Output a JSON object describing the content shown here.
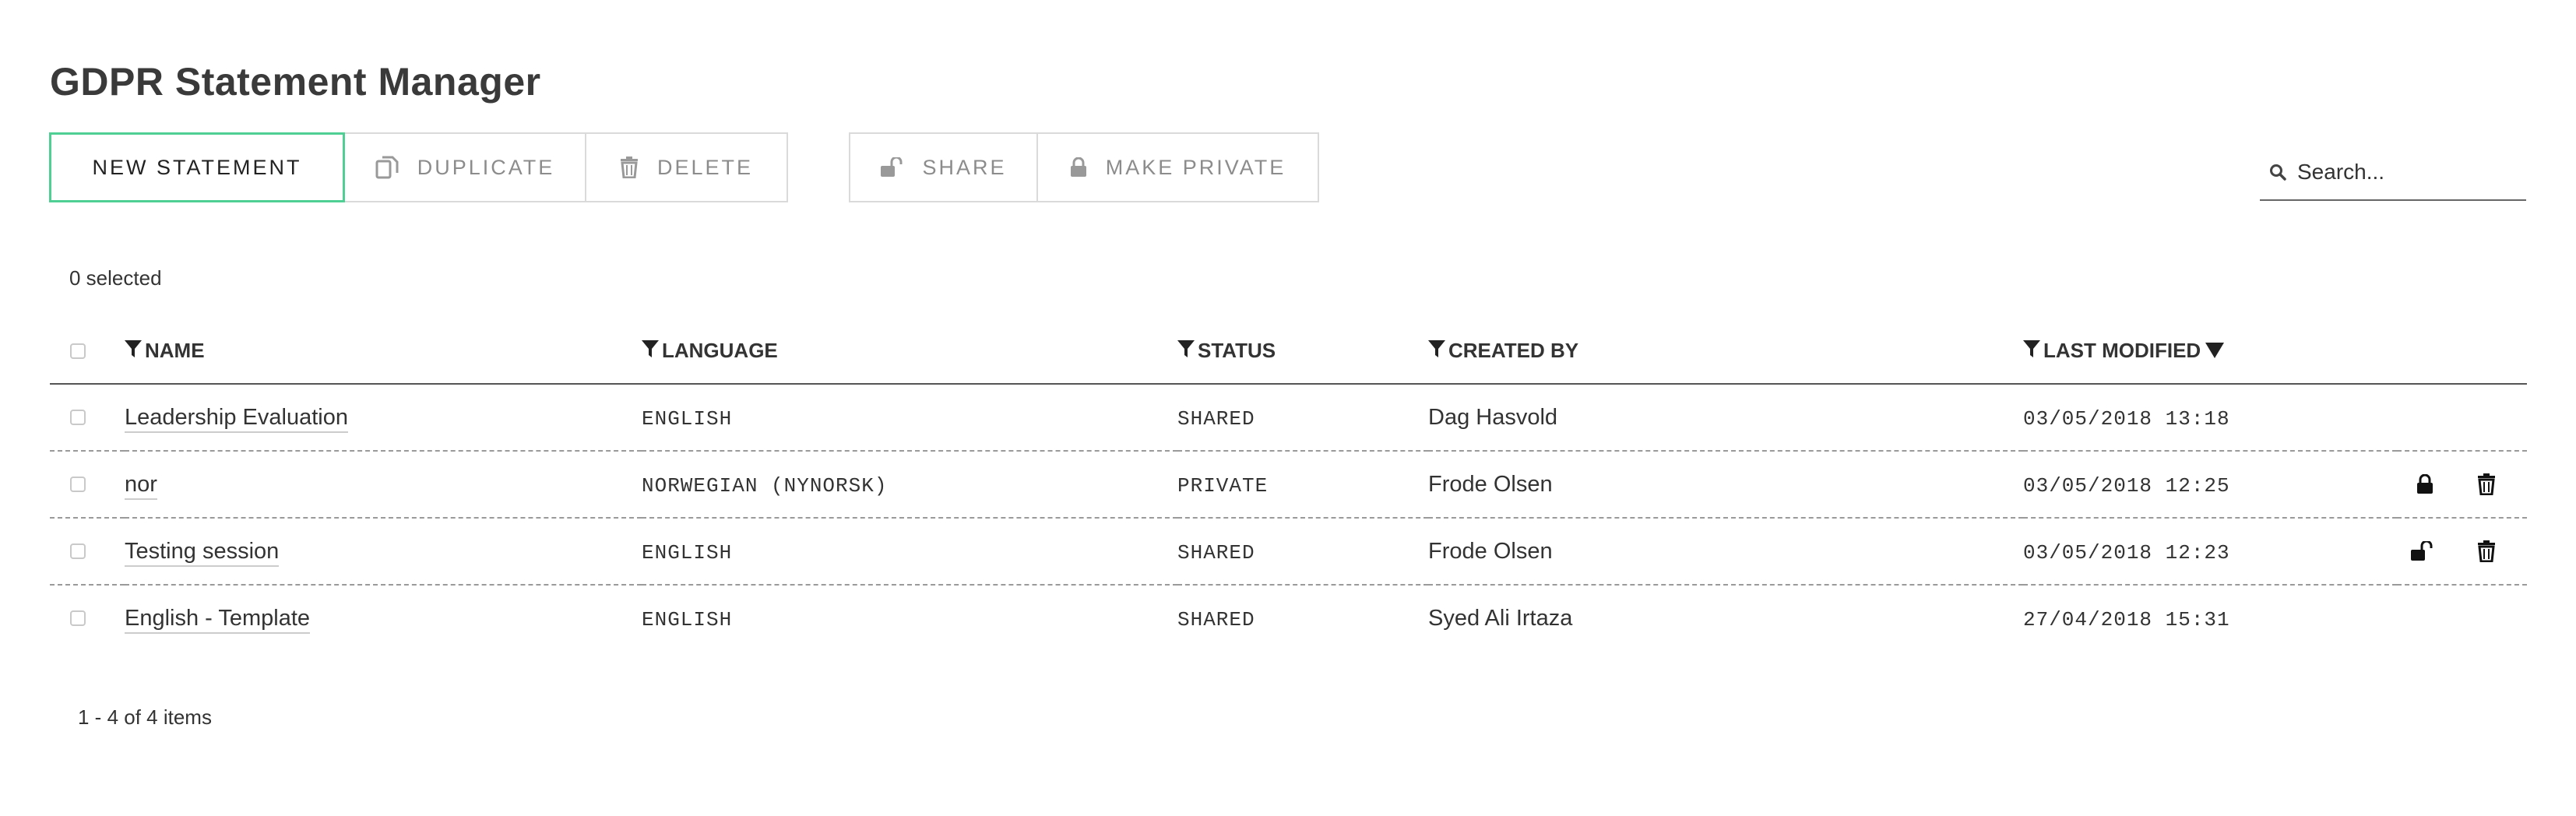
{
  "page": {
    "title": "GDPR Statement Manager",
    "selected_count": "0 selected",
    "pager": "1 - 4 of 4 items"
  },
  "toolbar": {
    "new_label": "NEW STATEMENT",
    "duplicate_label": "DUPLICATE",
    "delete_label": "DELETE",
    "share_label": "SHARE",
    "make_private_label": "MAKE PRIVATE"
  },
  "search": {
    "placeholder": "Search..."
  },
  "table": {
    "headers": {
      "name": "NAME",
      "language": "LANGUAGE",
      "status": "STATUS",
      "created_by": "CREATED BY",
      "last_modified": "LAST MODIFIED"
    },
    "rows": [
      {
        "name": "Leadership Evaluation",
        "language": "ENGLISH",
        "status": "SHARED",
        "created_by": "Dag Hasvold",
        "last_modified": "03/05/2018 13:18",
        "actions": []
      },
      {
        "name": "nor",
        "language": "NORWEGIAN (NYNORSK)",
        "status": "PRIVATE",
        "created_by": "Frode Olsen",
        "last_modified": "03/05/2018 12:25",
        "actions": [
          "lock-icon",
          "trash-icon"
        ]
      },
      {
        "name": "Testing session",
        "language": "ENGLISH",
        "status": "SHARED",
        "created_by": "Frode Olsen",
        "last_modified": "03/05/2018 12:23",
        "actions": [
          "unlock-icon",
          "trash-icon"
        ]
      },
      {
        "name": "English - Template",
        "language": "ENGLISH",
        "status": "SHARED",
        "created_by": "Syed Ali Irtaza",
        "last_modified": "27/04/2018 15:31",
        "actions": []
      }
    ]
  },
  "colors": {
    "accent": "#4fcf94",
    "border": "#dadada",
    "muted_text": "#8c8c8c"
  }
}
